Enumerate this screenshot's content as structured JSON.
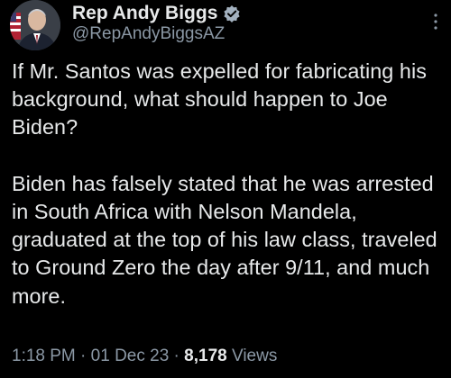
{
  "author": {
    "display_name": "Rep Andy Biggs",
    "handle": "@RepAndyBiggsAZ",
    "verified_badge_icon": "verified-badge-icon",
    "verified_color": "#a3b1bf"
  },
  "tweet": {
    "text": "If Mr. Santos was expelled for fabricating his background, what should happen to Joe Biden?\n\nBiden has falsely stated that he was arrested in South Africa with Nelson Mandela, graduated at the top of his law class, traveled to Ground Zero the day after 9/11, and much more."
  },
  "meta": {
    "time": "1:18 PM",
    "sep1": " · ",
    "date": "01 Dec 23",
    "sep2": " · ",
    "views_count": "8,178",
    "views_label": " Views"
  },
  "colors": {
    "background": "#000000",
    "primary_text": "#e7e9ea",
    "secondary_text": "#8b98a5"
  }
}
